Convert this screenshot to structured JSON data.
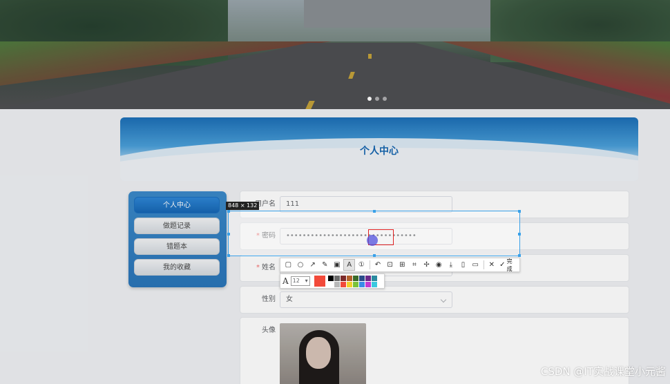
{
  "banner": {
    "carousel_dots": 3,
    "active_dot": 1
  },
  "header": {
    "title": "个人中心"
  },
  "sidebar": {
    "items": [
      {
        "label": "个人中心",
        "active": true
      },
      {
        "label": "做题记录",
        "active": false
      },
      {
        "label": "错题本",
        "active": false
      },
      {
        "label": "我的收藏",
        "active": false
      }
    ]
  },
  "form": {
    "username": {
      "label": "用户名",
      "value": "111"
    },
    "password": {
      "label": "密码",
      "required": "*",
      "value": "••••••••••••••••••••••••••••••••"
    },
    "name": {
      "label": "姓名",
      "required": "*"
    },
    "gender": {
      "label": "性别",
      "value": "女"
    },
    "avatar": {
      "label": "头像"
    }
  },
  "capture": {
    "dimensions": "848 × 132",
    "font_size": "12",
    "current_color": "#f24a3a",
    "done_label": "完成",
    "palette": [
      "#000000",
      "#6b6b6b",
      "#7b2a2a",
      "#b45f2a",
      "#3a6b2a",
      "#2a4c8a",
      "#6a2a8a",
      "#2a8aa0",
      "#ffffff",
      "#b8b8b8",
      "#f24a3a",
      "#f2d02a",
      "#7ac23a",
      "#3a8ae8",
      "#c23ad0",
      "#3ac8e0"
    ]
  },
  "watermark": "CSDN @IT实战课堂小元酱"
}
